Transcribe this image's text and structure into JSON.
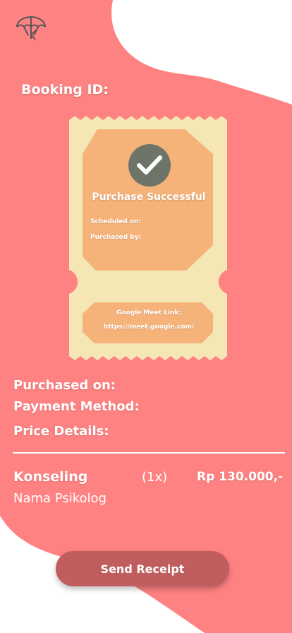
{
  "colors": {
    "background": "#ff8282",
    "wave": "#ffffff",
    "ticket": "#f4e6b5",
    "ticket_panel": "#f5b279",
    "check_circle": "#6e7568",
    "button": "#c05e5f"
  },
  "header": {
    "logo_icon": "umbrella-icon"
  },
  "booking": {
    "id_label": "Booking ID:"
  },
  "ticket": {
    "status_icon": "check-icon",
    "title": "Purchase Successful",
    "scheduled_label": "Scheduled on:",
    "purchased_by_label": "Purchased by:",
    "meet_link_label": "Google Meet Link:",
    "meet_link_url": "https://meet.google.com/"
  },
  "details": {
    "purchased_on_label": "Purchased on:",
    "payment_method_label": "Payment Method:",
    "price_details_label": "Price Details:"
  },
  "item": {
    "name": "Konseling",
    "quantity": "(1x)",
    "price": "Rp 130.000,-",
    "psychologist": "Nama Psikolog"
  },
  "actions": {
    "send_receipt_label": "Send Receipt"
  }
}
